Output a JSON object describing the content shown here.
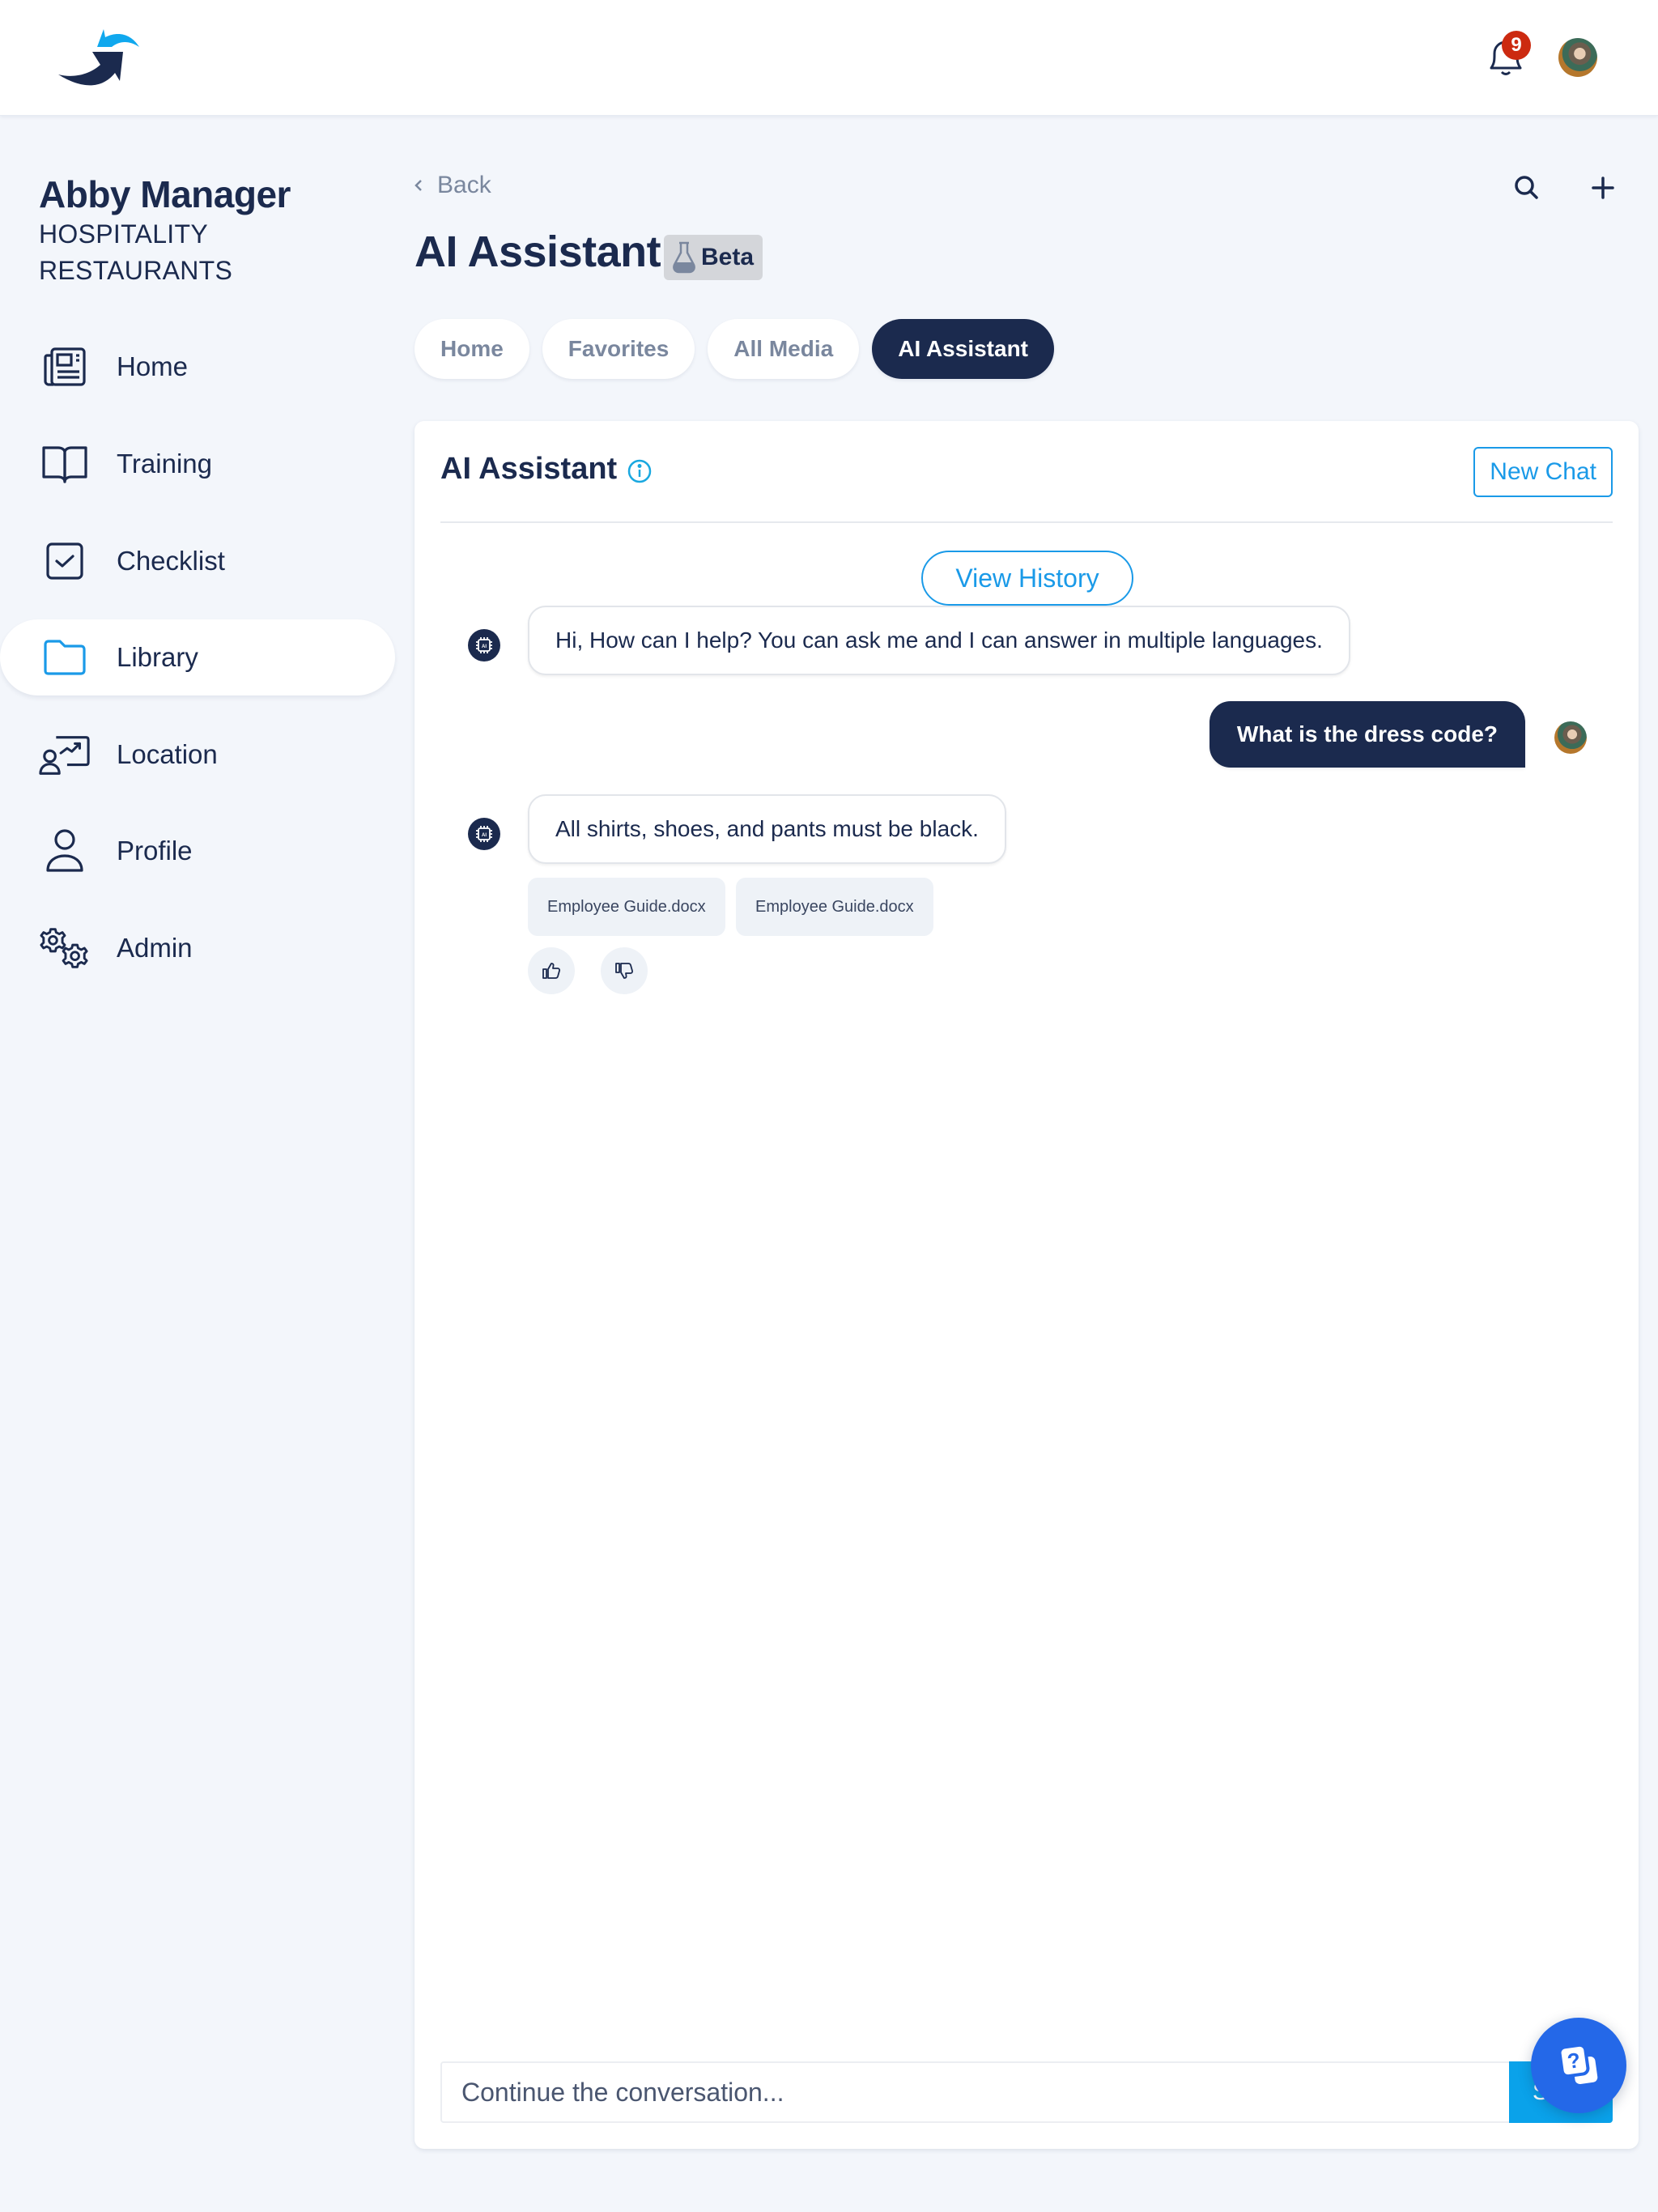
{
  "topbar": {
    "logo": "brand-logo",
    "notifications_count": "9",
    "icons": {
      "bell": "bell-icon",
      "avatar": "user-avatar"
    }
  },
  "sidebar": {
    "user_name": "Abby Manager",
    "org_line1": "HOSPITALITY",
    "org_line2": "RESTAURANTS",
    "items": [
      {
        "label": "Home",
        "icon": "newspaper-icon",
        "active": false
      },
      {
        "label": "Training",
        "icon": "book-icon",
        "active": false
      },
      {
        "label": "Checklist",
        "icon": "checkbox-icon",
        "active": false
      },
      {
        "label": "Library",
        "icon": "folder-icon",
        "active": true
      },
      {
        "label": "Location",
        "icon": "location-presenter-icon",
        "active": false
      },
      {
        "label": "Profile",
        "icon": "person-icon",
        "active": false
      },
      {
        "label": "Admin",
        "icon": "gears-icon",
        "active": false
      }
    ]
  },
  "header": {
    "back_label": "Back",
    "title": "AI Assistant",
    "badge": "Beta"
  },
  "tabs": [
    {
      "label": "Home",
      "active": false
    },
    {
      "label": "Favorites",
      "active": false
    },
    {
      "label": "All Media",
      "active": false
    },
    {
      "label": "AI Assistant",
      "active": true
    }
  ],
  "card": {
    "title": "AI Assistant",
    "new_chat_label": "New Chat",
    "view_history_label": "View History",
    "messages": [
      {
        "role": "assistant",
        "text": "Hi, How can I help? You can ask me and I can answer in multiple languages."
      },
      {
        "role": "user",
        "text": "What is the dress code?"
      },
      {
        "role": "assistant",
        "text": "All shirts, shoes, and pants must be black.",
        "sources": [
          "Employee Guide.docx",
          "Employee Guide.docx"
        ]
      }
    ],
    "composer": {
      "placeholder": "Continue the conversation...",
      "value": "",
      "send_label": "Send"
    }
  },
  "colors": {
    "navy": "#1b2a4e",
    "accent": "#1a9ae8",
    "send": "#0aa2ea",
    "fab": "#2468e8",
    "badge": "#cc2a10",
    "background": "#f3f6fb"
  }
}
